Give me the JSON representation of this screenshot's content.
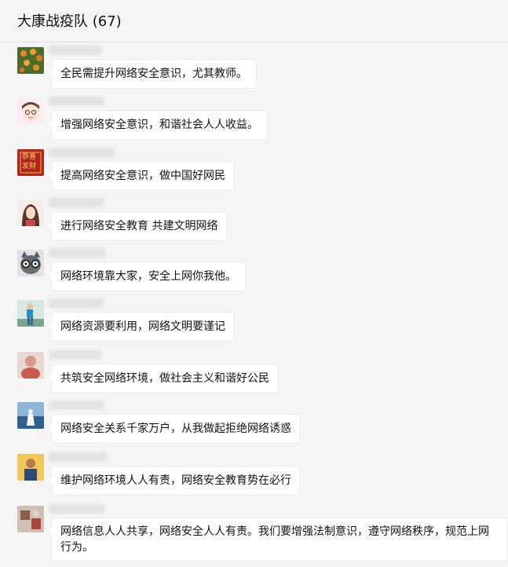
{
  "header": {
    "title": "大康战疫队 (67)"
  },
  "messages": [
    {
      "text": "全民需提升网络安全意识，尤其教师。"
    },
    {
      "text": "增强网络安全意识，和谐社会人人收益。"
    },
    {
      "text": "提高网络安全意识，做中国好网民"
    },
    {
      "text": "进行网络安全教育 共建文明网络"
    },
    {
      "text": "网络环境靠大家，安全上网你我他。"
    },
    {
      "text": "网络资源要利用，网络文明要谨记"
    },
    {
      "text": "共筑安全网络环境，做社会主义和谐好公民"
    },
    {
      "text": "网络安全关系千家万户，从我做起拒绝网络诱惑"
    },
    {
      "text": "维护网络环境人人有责，网络安全教育势在必行"
    },
    {
      "text": "网络信息人人共享，网络安全人人有责。我们要增强法制意识，遵守网络秩序，规范上网行为。"
    }
  ],
  "avatar_badge_text": "恭喜发财"
}
